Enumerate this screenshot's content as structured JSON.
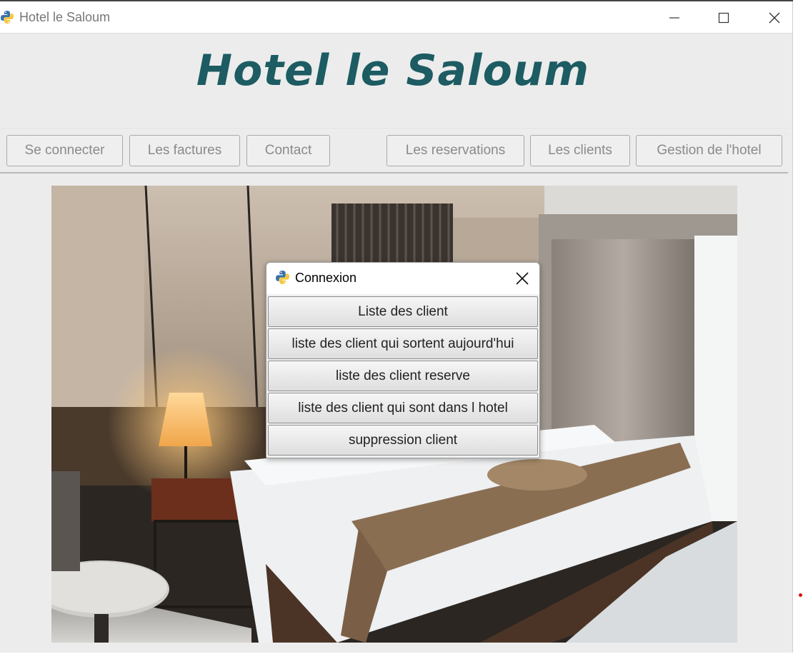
{
  "window": {
    "title": "Hotel le Saloum",
    "controls": [
      "minimize-icon",
      "maximize-icon",
      "close-icon"
    ]
  },
  "header": {
    "title": "Hotel le Saloum",
    "title_color": "#1c5c62"
  },
  "nav": {
    "se_connecter": "Se connecter",
    "factures": "Les factures",
    "contact": "Contact",
    "reservations": "Les reservations",
    "clients": "Les clients",
    "gestion": "Gestion de l'hotel"
  },
  "background_image": "hotel-room-photo",
  "dialog": {
    "title": "Connexion",
    "icon": "python-icon",
    "buttons": {
      "liste_client": "Liste des client",
      "sortent_aujourdhui": "liste des client qui sortent aujourd'hui",
      "client_reserve": "liste des client reserve",
      "dans_hotel": "liste des client qui sont dans l hotel",
      "suppression": "suppression client"
    }
  }
}
